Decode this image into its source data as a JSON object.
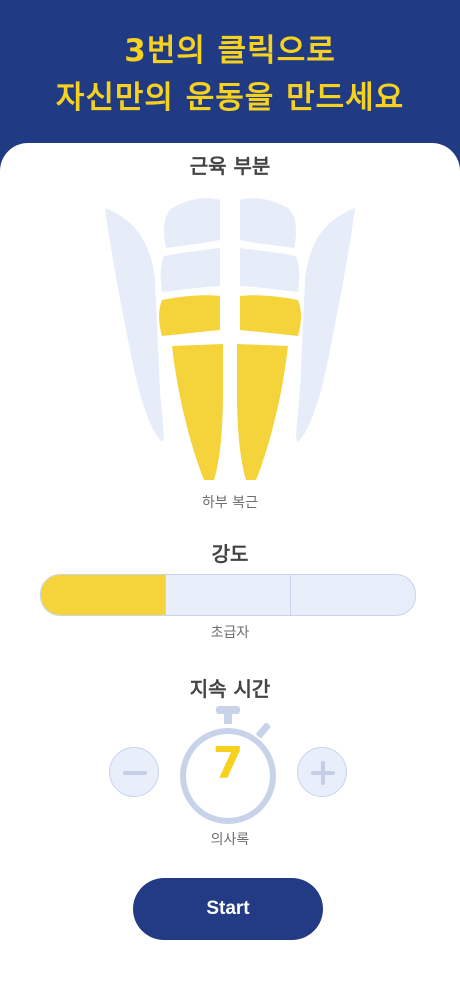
{
  "header": {
    "line1": "3번의 클릭으로",
    "line2": "자신만의 운동을 만드세요"
  },
  "muscle": {
    "title": "근육 부분",
    "selected_label": "하부 복근"
  },
  "intensity": {
    "title": "강도",
    "selected_label": "초급자",
    "level": 1,
    "levels_total": 3
  },
  "duration": {
    "title": "지속 시간",
    "value": "7",
    "unit_label": "의사록"
  },
  "start_label": "Start",
  "colors": {
    "header_bg": "#213a84",
    "accent": "#f6d21f",
    "muted": "#e8eefa",
    "button": "#233a85"
  }
}
